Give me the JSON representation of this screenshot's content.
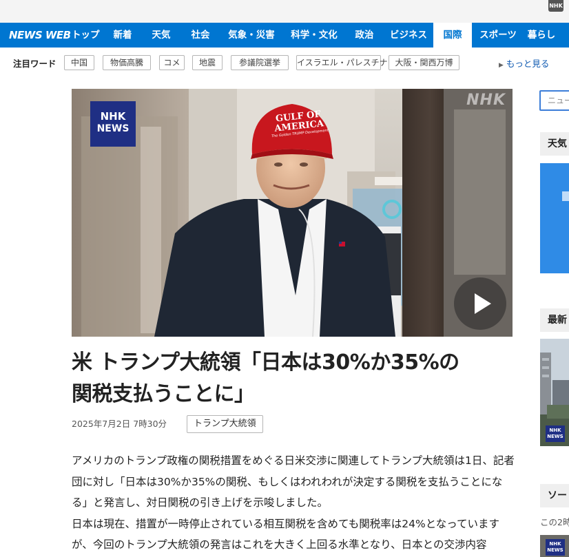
{
  "header": {
    "corner_logo": "NHK",
    "brand": "NEWS WEB",
    "nav": [
      "トップ",
      "新着",
      "天気",
      "社会",
      "気象・災害",
      "科学・文化",
      "政治",
      "ビジネス",
      "国際",
      "スポーツ",
      "暮らし"
    ],
    "active_nav": "国際",
    "accent_color": "#0076d1"
  },
  "trending": {
    "label": "注目ワード",
    "chips": [
      "中国",
      "物価高騰",
      "コメ",
      "地震",
      "参議院選挙",
      "イスラエル・パレスチナ",
      "大阪・関西万博"
    ],
    "more": "もっと見る"
  },
  "hero": {
    "badge_line1": "NHK",
    "badge_line2": "NEWS",
    "watermark": "NHK",
    "hat_line1": "GULF OF",
    "hat_line2": "AMERICA",
    "hat_small": "The Golden TRUMP Development",
    "play_icon": "play-icon"
  },
  "article": {
    "title_line1": "米 トランプ大統領「日本は30%か35%の",
    "title_line2": "関税支払うことに」",
    "date": "2025年7月2日 7時30分",
    "tag": "トランプ大統領",
    "paragraph1": "アメリカのトランプ政権の関税措置をめぐる日米交渉に関連してトランプ大統領は1日、記者団に対し「日本は30%か35%の関税、もしくはわれわれが決定する関税を支払うことになる」と発言し、対日関税の引き上げを示唆しました。",
    "paragraph2": "日本は現在、措置が一時停止されている相互関税を含めても関税率は24%となっていますが、今回のトランプ大統領の発言はこれを大きく上回る水準となり、日本との交渉内容"
  },
  "sidebar": {
    "search_placeholder": "ニュー",
    "weather_title": "天気",
    "latest_title": "最新",
    "section3_title": "ソー",
    "section3_sub": "この2時",
    "mini_badge_line1": "NHK",
    "mini_badge_line2": "NEWS"
  }
}
